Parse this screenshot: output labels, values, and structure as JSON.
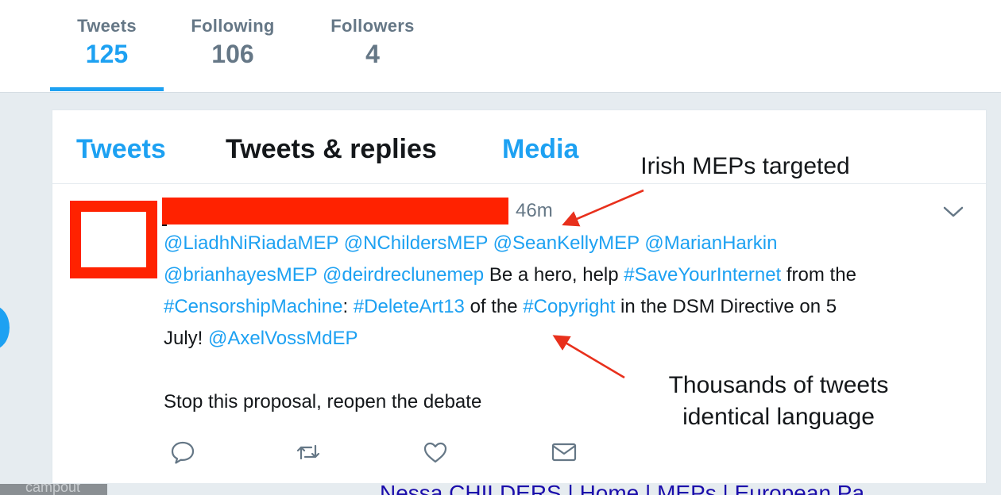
{
  "profile_nav": {
    "stats": [
      {
        "label": "Tweets",
        "value": "125"
      },
      {
        "label": "Following",
        "value": "106"
      },
      {
        "label": "Followers",
        "value": "4"
      }
    ]
  },
  "timeline": {
    "tabs": [
      "Tweets",
      "Tweets & replies",
      "Media"
    ],
    "tweet": {
      "timestamp": "46m",
      "line1": {
        "a": "@LiadhNiRiadaMEP @NChildersMEP @SeanKellyMEP @MarianHarkin"
      },
      "line2": {
        "a": "@brianhayesMEP @deirdreclunemep",
        "b": " Be a hero, help ",
        "c": "#SaveYourInternet",
        "d": " from the"
      },
      "line3": {
        "a": "#CensorshipMachine",
        "b": ": ",
        "c": "#DeleteArt13",
        "d": " of the ",
        "e": "#Copyright",
        "f": " in the DSM Directive on 5"
      },
      "line4": {
        "a": "July! ",
        "b": "@AxelVossMdEP"
      },
      "paragraph2": "Stop this proposal, reopen the debate",
      "actions": [
        "reply-icon",
        "retweet-icon",
        "like-icon",
        "direct-message-icon"
      ]
    }
  },
  "annotations": {
    "top": "Irish MEPs targeted",
    "bottom_line1": "Thousands of tweets",
    "bottom_line2": "identical language"
  },
  "background": {
    "thumb_text": "campout",
    "link_text": "Nessa CHILDERS | Home | MEPs | European Pa"
  },
  "colors": {
    "accent": "#1da1f2",
    "muted": "#657786",
    "annotation_red": "#ff2200",
    "arrow_red": "#e8301c"
  }
}
